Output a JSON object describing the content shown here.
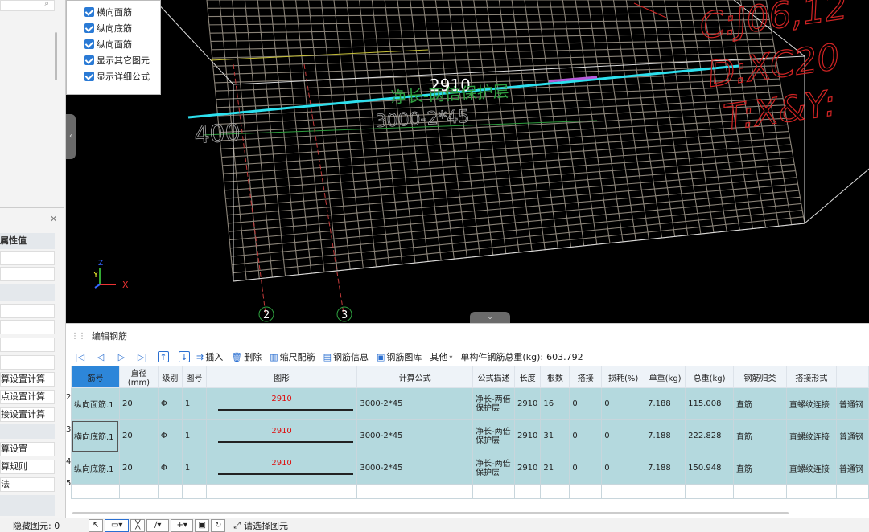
{
  "left_panel": {
    "properties_header": "属性值",
    "items": [
      "算设置计算",
      "点设置计算",
      "接设置计算",
      "算设置",
      "算规则",
      "法"
    ]
  },
  "display_options": [
    {
      "label": "横向面筋",
      "checked": true
    },
    {
      "label": "纵向底筋",
      "checked": true
    },
    {
      "label": "纵向面筋",
      "checked": true
    },
    {
      "label": "显示其它图元",
      "checked": true
    },
    {
      "label": "显示详细公式",
      "checked": true
    }
  ],
  "viewport": {
    "dim_value": "2910",
    "label_formula_desc": "净长-两倍保护层",
    "label_formula": "3000-2*45",
    "label_side": "400",
    "red_text_lines": [
      "C:J06,12",
      "D:XC20",
      "T:X&Y:"
    ],
    "axis_labels": [
      "2",
      "3"
    ],
    "triad": {
      "x": "X",
      "y": "Y",
      "z": "Z"
    }
  },
  "editor": {
    "title": "编辑钢筋",
    "toolbar": {
      "insert": "插入",
      "delete": "删除",
      "scale": "缩尺配筋",
      "info": "钢筋信息",
      "library": "钢筋图库",
      "other": "其他",
      "total_label": "单构件钢筋总重(kg):",
      "total_value": "603.792"
    },
    "columns": [
      "筋号",
      "直径(mm)",
      "级别",
      "图号",
      "图形",
      "计算公式",
      "公式描述",
      "长度",
      "根数",
      "搭接",
      "损耗(%)",
      "单重(kg)",
      "总重(kg)",
      "钢筋归类",
      "搭接形式",
      ""
    ],
    "rows": [
      {
        "num": "2",
        "name": "纵向面筋.1",
        "diameter": "20",
        "grade": "Φ",
        "fig": "1",
        "shape_value": "2910",
        "formula": "3000-2*45",
        "desc": "净长-两倍保护层",
        "length": "2910",
        "count": "16",
        "lap": "0",
        "loss": "0",
        "unit_weight": "7.188",
        "total_weight": "115.008",
        "category": "直筋",
        "lap_type": "直螺纹连接",
        "extra": "普通钢"
      },
      {
        "num": "3",
        "name": "横向底筋.1",
        "diameter": "20",
        "grade": "Φ",
        "fig": "1",
        "shape_value": "2910",
        "formula": "3000-2*45",
        "desc": "净长-两倍保护层",
        "length": "2910",
        "count": "31",
        "lap": "0",
        "loss": "0",
        "unit_weight": "7.188",
        "total_weight": "222.828",
        "category": "直筋",
        "lap_type": "直螺纹连接",
        "extra": "普通钢"
      },
      {
        "num": "4",
        "name": "纵向底筋.1",
        "diameter": "20",
        "grade": "Φ",
        "fig": "1",
        "shape_value": "2910",
        "formula": "3000-2*45",
        "desc": "净长-两倍保护层",
        "length": "2910",
        "count": "21",
        "lap": "0",
        "loss": "0",
        "unit_weight": "7.188",
        "total_weight": "150.948",
        "category": "直筋",
        "lap_type": "直螺纹连接",
        "extra": "普通钢"
      }
    ],
    "empty_row_num": "5"
  },
  "status": {
    "hidden_label": "隐藏图元: 0",
    "select_hint": "请选择图元"
  }
}
